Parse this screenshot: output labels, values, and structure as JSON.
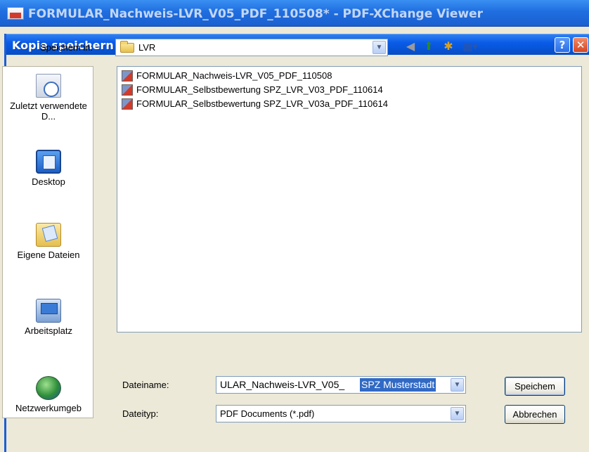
{
  "app": {
    "title": "FORMULAR_Nachweis-LVR_V05_PDF_110508* - PDF-XChange Viewer"
  },
  "dialog": {
    "title": "Kopie speichern unter...",
    "help_glyph": "?",
    "close_glyph": "✕"
  },
  "save_in": {
    "label": "Speichem in:",
    "value": "LVR",
    "icon": "folder-icon"
  },
  "toolbar": {
    "back_icon": "back-arrow-icon",
    "up_icon": "up-folder-icon",
    "new_folder_icon": "new-folder-icon",
    "view_menu_icon": "view-menu-icon"
  },
  "places": [
    {
      "label": "Zuletzt verwendete D...",
      "icon": "recent-documents-icon"
    },
    {
      "label": "Desktop",
      "icon": "desktop-icon"
    },
    {
      "label": "Eigene Dateien",
      "icon": "my-documents-icon"
    },
    {
      "label": "Arbeitsplatz",
      "icon": "my-computer-icon"
    },
    {
      "label": "Netzwerkumgeb",
      "icon": "network-places-icon"
    }
  ],
  "files": [
    {
      "name": "FORMULAR_Nachweis-LVR_V05_PDF_110508",
      "icon": "pdf-file-icon"
    },
    {
      "name": "FORMULAR_Selbstbewertung SPZ_LVR_V03_PDF_110614",
      "icon": "pdf-file-icon"
    },
    {
      "name": "FORMULAR_Selbstbewertung SPZ_LVR_V03a_PDF_110614",
      "icon": "pdf-file-icon"
    }
  ],
  "filename": {
    "label": "Dateiname:",
    "value_prefix": "ULAR_Nachweis-LVR_V05_",
    "value_selected": "SPZ Musterstadt"
  },
  "filetype": {
    "label": "Dateityp:",
    "value": "PDF Documents (*.pdf)"
  },
  "buttons": {
    "save": "Speichem",
    "cancel": "Abbrechen"
  }
}
